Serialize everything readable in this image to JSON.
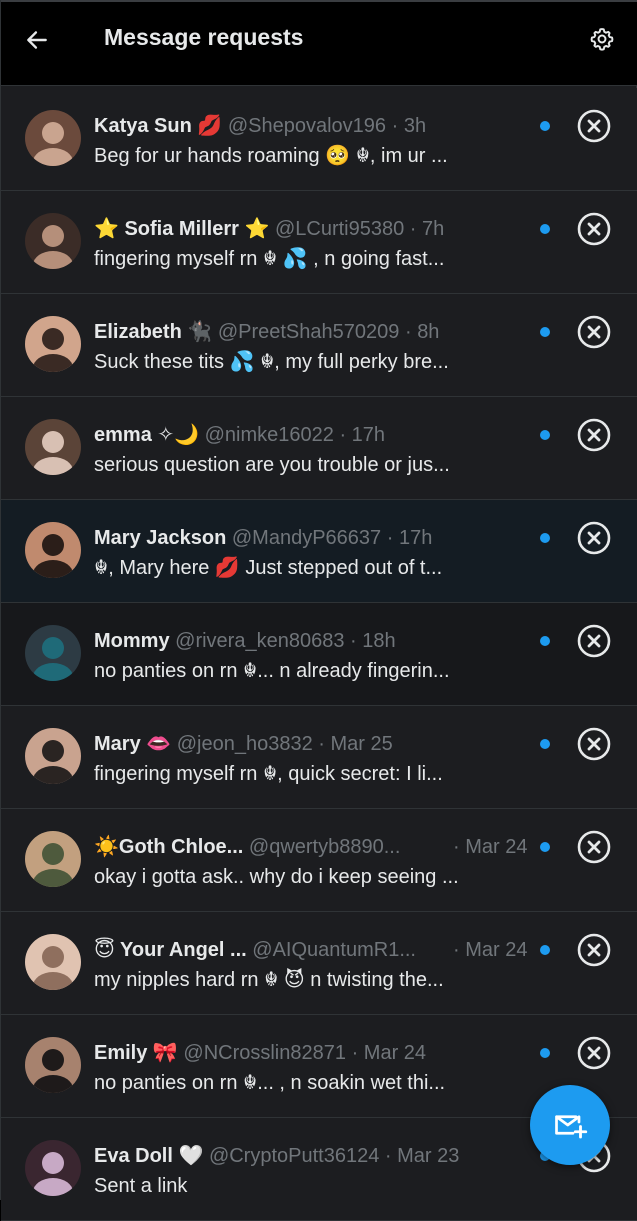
{
  "header": {
    "title": "Message requests",
    "back_icon": "arrow-left-icon",
    "settings_icon": "gear-icon"
  },
  "colors": {
    "accent": "#1d9bf0",
    "background": "#1c1d20",
    "muted": "#71767b"
  },
  "requests": [
    {
      "name": "Katya Sun 💋",
      "handle": "@Shepovalov196",
      "time": "3h",
      "preview": "Beg for ur hands roaming 🥺 ☬, im ur ..."
    },
    {
      "name": "⭐ Sofia Millerr ⭐",
      "handle": "@LCurti95380",
      "time": "7h",
      "preview": "fingering myself rn ☬ 💦 , n going fast..."
    },
    {
      "name": "Elizabeth 🐈‍⬛",
      "handle": "@PreetShah570209",
      "time": "8h",
      "preview": "Suck these tits 💦 ☬, my full perky bre..."
    },
    {
      "name": "emma ✧🌙",
      "handle": "@nimke16022",
      "time": "17h",
      "preview": "serious question are you trouble or jus..."
    },
    {
      "name": "Mary Jackson",
      "handle": "@MandyP66637",
      "time": "17h",
      "preview": "☬, Mary here 💋 Just stepped out of t..."
    },
    {
      "name": "Mommy",
      "handle": "@rivera_ken80683",
      "time": "18h",
      "preview": "no panties on rn ☬... n already fingerin..."
    },
    {
      "name": "Mary 👄",
      "handle": "@jeon_ho3832",
      "time": "Mar 25",
      "preview": "fingering myself rn ☬, quick secret: I li..."
    },
    {
      "name": "☀️Goth Chloe...",
      "handle": "@qwertyb8890...",
      "time": "Mar 24",
      "preview": "okay i gotta ask.. why do i keep seeing ..."
    },
    {
      "name": "😇 Your Angel ...",
      "handle": "@AIQuantumR1...",
      "time": "Mar 24",
      "preview": "my nipples hard rn ☬ 😈 n twisting the..."
    },
    {
      "name": "Emily 🎀",
      "handle": "@NCrosslin82871",
      "time": "Mar 24",
      "preview": "no panties on rn ☬... , n soakin wet thi..."
    },
    {
      "name": "Eva Doll 🤍",
      "handle": "@CryptoPutt36124",
      "time": "Mar 23",
      "preview": "Sent a link"
    }
  ],
  "row_icons": {
    "decline": "close-circle-icon",
    "unread": "unread-dot"
  },
  "fab": {
    "icon": "new-message-icon"
  }
}
